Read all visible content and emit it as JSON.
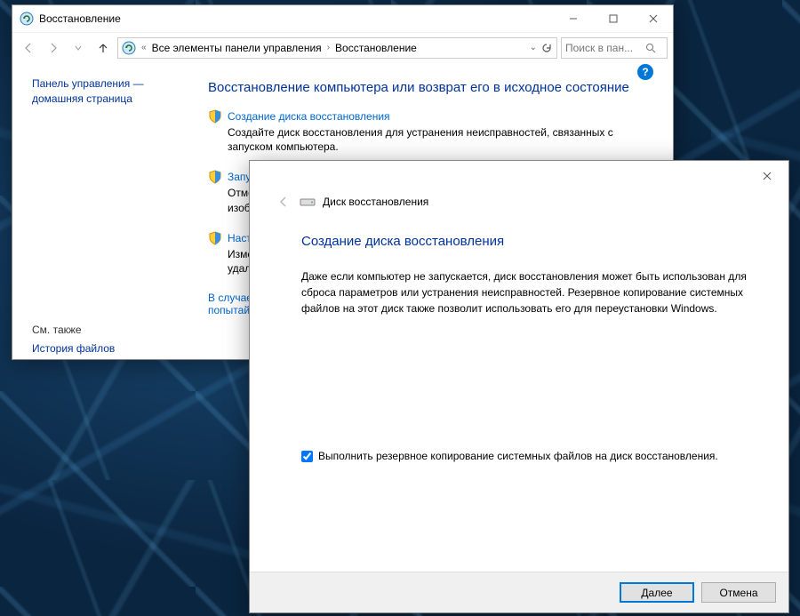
{
  "win1": {
    "title": "Восстановление",
    "breadcrumb": {
      "item1": "Все элементы панели управления",
      "item2": "Восстановление"
    },
    "search_placeholder": "Поиск в пан...",
    "sidebar": {
      "home_line1": "Панель управления —",
      "home_line2": "домашняя страница",
      "see_also": "См. также",
      "history": "История файлов"
    },
    "main": {
      "heading": "Восстановление компьютера или возврат его в исходное состояние",
      "sec1_link": "Создание диска восстановления",
      "sec1_desc": "Создайте диск восстановления для устранения неисправностей, связанных с запуском компьютера.",
      "sec2_link": "Запу",
      "sec2_desc1": "Отмена",
      "sec2_desc2": "изображ",
      "sec3_link": "Наст",
      "sec3_desc1": "Измене",
      "sec3_desc2": "удалени",
      "footer_link1": "В случае",
      "footer_link2": "попытай"
    }
  },
  "win2": {
    "title": "Диск восстановления",
    "heading": "Создание диска восстановления",
    "body": "Даже если компьютер не запускается, диск восстановления может быть использован для сброса параметров или устранения неисправностей. Резервное копирование системных файлов на этот диск также позволит использовать его для переустановки Windows.",
    "checkbox_label": "Выполнить резервное копирование системных файлов на диск восстановления.",
    "btn_next": "Далее",
    "btn_cancel": "Отмена"
  }
}
